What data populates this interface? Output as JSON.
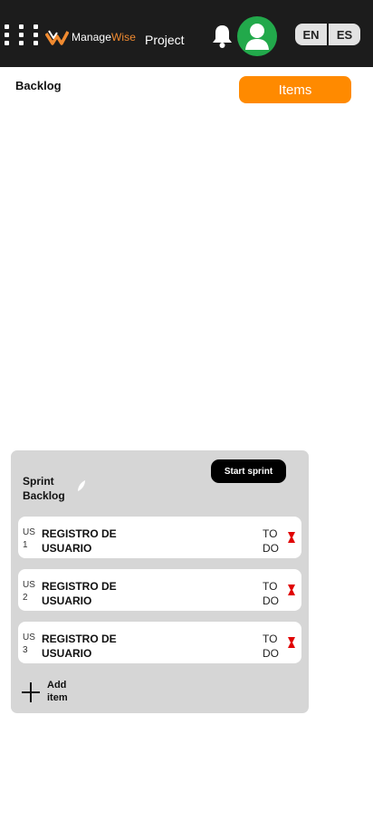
{
  "header": {
    "logo_main": "Manage",
    "logo_accent": "Wise",
    "project_label": "Project",
    "languages": [
      "EN",
      "ES"
    ],
    "colors": {
      "background": "#1c1c1c",
      "logo_accent": "#f08a30",
      "avatar": "#22a94b"
    },
    "icons": [
      "grid-icon",
      "logo-icon",
      "bell-icon",
      "user-avatar-icon"
    ]
  },
  "main": {
    "title": "Backlog",
    "items_button": "Items",
    "items_button_color": "#ff8a00"
  },
  "sprint": {
    "title": "Sprint Backlog",
    "start_button": "Start sprint",
    "stories": [
      {
        "id": "US 1",
        "name": "REGISTRO DE USUARIO",
        "status": "TO DO"
      },
      {
        "id": "US 2",
        "name": "REGISTRO DE USUARIO",
        "status": "TO DO"
      },
      {
        "id": "US 3",
        "name": "REGISTRO DE USUARIO",
        "status": "TO DO"
      }
    ],
    "add_item": "Add item",
    "delete_icon_color": "#e00000"
  }
}
